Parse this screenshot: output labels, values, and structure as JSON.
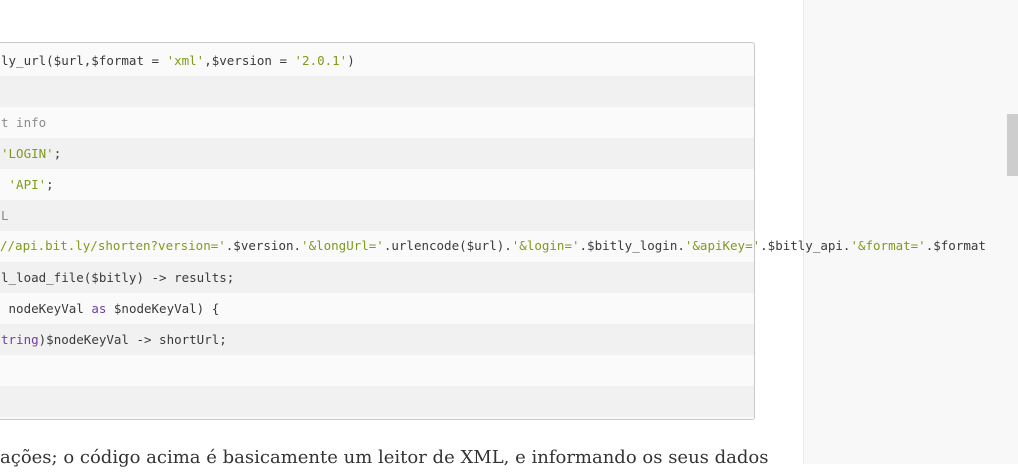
{
  "code": {
    "lines": [
      {
        "parts": [
          {
            "t": "ly_url($url,$format = "
          },
          {
            "t": "'xml'",
            "c": "str"
          },
          {
            "t": ",$version = "
          },
          {
            "t": "'2.0.1'",
            "c": "str"
          },
          {
            "t": ")"
          }
        ]
      },
      {
        "parts": [
          {
            "t": ""
          }
        ]
      },
      {
        "parts": [
          {
            "t": "t info",
            "c": "cm"
          }
        ]
      },
      {
        "parts": [
          {
            "t": "'LOGIN'",
            "c": "str"
          },
          {
            "t": ";"
          }
        ]
      },
      {
        "parts": [
          {
            "t": " "
          },
          {
            "t": "'API'",
            "c": "str"
          },
          {
            "t": ";"
          }
        ]
      },
      {
        "parts": [
          {
            "t": "L",
            "c": "cm"
          }
        ]
      },
      {
        "parts": [
          {
            "t": "//api.bit.ly/shorten?version='",
            "c": "str"
          },
          {
            "t": ".$version."
          },
          {
            "t": "'&longUrl='",
            "c": "str"
          },
          {
            "t": ".urlencode($url)."
          },
          {
            "t": "'&login='",
            "c": "str"
          },
          {
            "t": ".$bitly_login."
          },
          {
            "t": "'&apiKey='",
            "c": "str"
          },
          {
            "t": ".$bitly_api."
          },
          {
            "t": "'&format='",
            "c": "str"
          },
          {
            "t": ".$format"
          }
        ]
      },
      {
        "parts": [
          {
            "t": "l_load_file($bitly) -> results;"
          }
        ]
      },
      {
        "parts": [
          {
            "t": " nodeKeyVal "
          },
          {
            "t": "as",
            "c": "kw"
          },
          {
            "t": " $nodeKeyVal) {"
          }
        ]
      },
      {
        "parts": [
          {
            "t": "tring",
            "c": "kw"
          },
          {
            "t": ")$nodeKeyVal -> shortUrl;"
          }
        ]
      },
      {
        "parts": [
          {
            "t": ""
          }
        ]
      },
      {
        "parts": [
          {
            "t": ""
          }
        ]
      }
    ]
  },
  "article": {
    "paragraph": "ações; o código acima é basicamente um leitor de XML, e informando os seus dados"
  },
  "colors": {
    "string": "#7f9a1d",
    "keyword": "#6f3fa0",
    "comment": "#8a8a8a"
  }
}
